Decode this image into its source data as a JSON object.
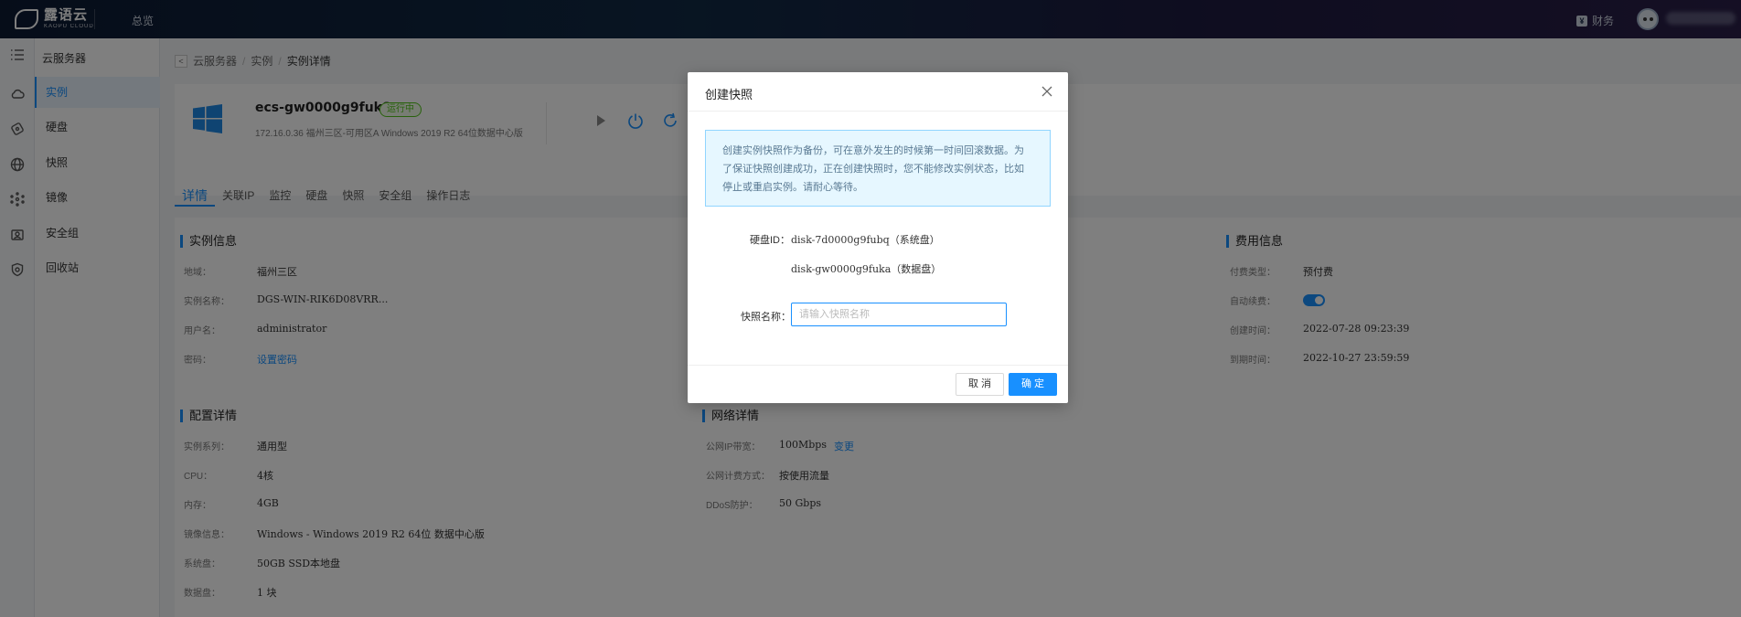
{
  "topbar": {
    "logo_cn": "露语云",
    "logo_en": "KAOPU CLOUD",
    "overview": "总览",
    "finance": "财务"
  },
  "sidebar": {
    "title": "云服务器",
    "items": [
      {
        "label": "实例",
        "icon": "cloud-icon",
        "active": true
      },
      {
        "label": "硬盘",
        "icon": "disk-icon"
      },
      {
        "label": "快照",
        "icon": "globe-icon"
      },
      {
        "label": "镜像",
        "icon": "network-icon"
      },
      {
        "label": "安全组",
        "icon": "shield-icon"
      },
      {
        "label": "回收站",
        "icon": "recycle-icon"
      }
    ]
  },
  "breadcrumb": [
    "云服务器",
    "实例",
    "实例详情"
  ],
  "instance": {
    "name": "ecs-gw0000g9fuk8",
    "status": "运行中",
    "meta": "172.16.0.36  福州三区-可用区A  Windows 2019 R2 64位数据中心版"
  },
  "tabs": [
    "详情",
    "关联IP",
    "监控",
    "硬盘",
    "快照",
    "安全组",
    "操作日志"
  ],
  "sections": {
    "instance_info": {
      "title": "实例信息",
      "rows": [
        {
          "k": "地域：",
          "v": "福州三区"
        },
        {
          "k": "实例名称：",
          "v": "DGS-WIN-RIK6D08VRR..."
        },
        {
          "k": "用户名：",
          "v": "administrator"
        },
        {
          "k": "密码：",
          "v": "设置密码"
        }
      ]
    },
    "billing_info": {
      "title": "费用信息",
      "rows": [
        {
          "k": "付费类型：",
          "v": "预付费"
        },
        {
          "k": "自动续费：",
          "v": ""
        },
        {
          "k": "创建时间：",
          "v": "2022-07-28 09:23:39"
        },
        {
          "k": "到期时间：",
          "v": "2022-10-27 23:59:59"
        }
      ]
    },
    "config": {
      "title": "配置详情",
      "rows": [
        {
          "k": "实例系列：",
          "v": "通用型"
        },
        {
          "k": "CPU：",
          "v": "4核"
        },
        {
          "k": "内存：",
          "v": "4GB"
        },
        {
          "k": "镜像信息：",
          "v": "Windows - Windows 2019 R2 64位 数据中心版"
        },
        {
          "k": "系统盘：",
          "v": "50GB SSD本地盘"
        },
        {
          "k": "数据盘：",
          "v": "1 块"
        }
      ]
    },
    "network": {
      "title": "网络详情",
      "rows": [
        {
          "k": "公网IP带宽：",
          "v": "100Mbps",
          "link": "变更"
        },
        {
          "k": "公网计费方式：",
          "v": "按使用流量"
        },
        {
          "k": "DDoS防护：",
          "v": "50 Gbps"
        }
      ]
    }
  },
  "modal": {
    "title": "创建快照",
    "notice": "创建实例快照作为备份，可在意外发生的时候第一时间回滚数据。为了保证快照创建成功，正在创建快照时，您不能修改实例状态，比如停止或重启实例。请耐心等待。",
    "disk_label": "硬盘ID：",
    "disks": [
      "disk-7d0000g9fubq（系统盘）",
      "disk-gw0000g9fuka（数据盘）"
    ],
    "snapshot_label": "快照名称：",
    "snapshot_placeholder": "请输入快照名称",
    "snapshot_value": "",
    "cancel": "取 消",
    "ok": "确 定"
  },
  "colors": {
    "accent": "#1890ff",
    "running": "#52c41a",
    "notice_bg": "#e6f7ff"
  }
}
